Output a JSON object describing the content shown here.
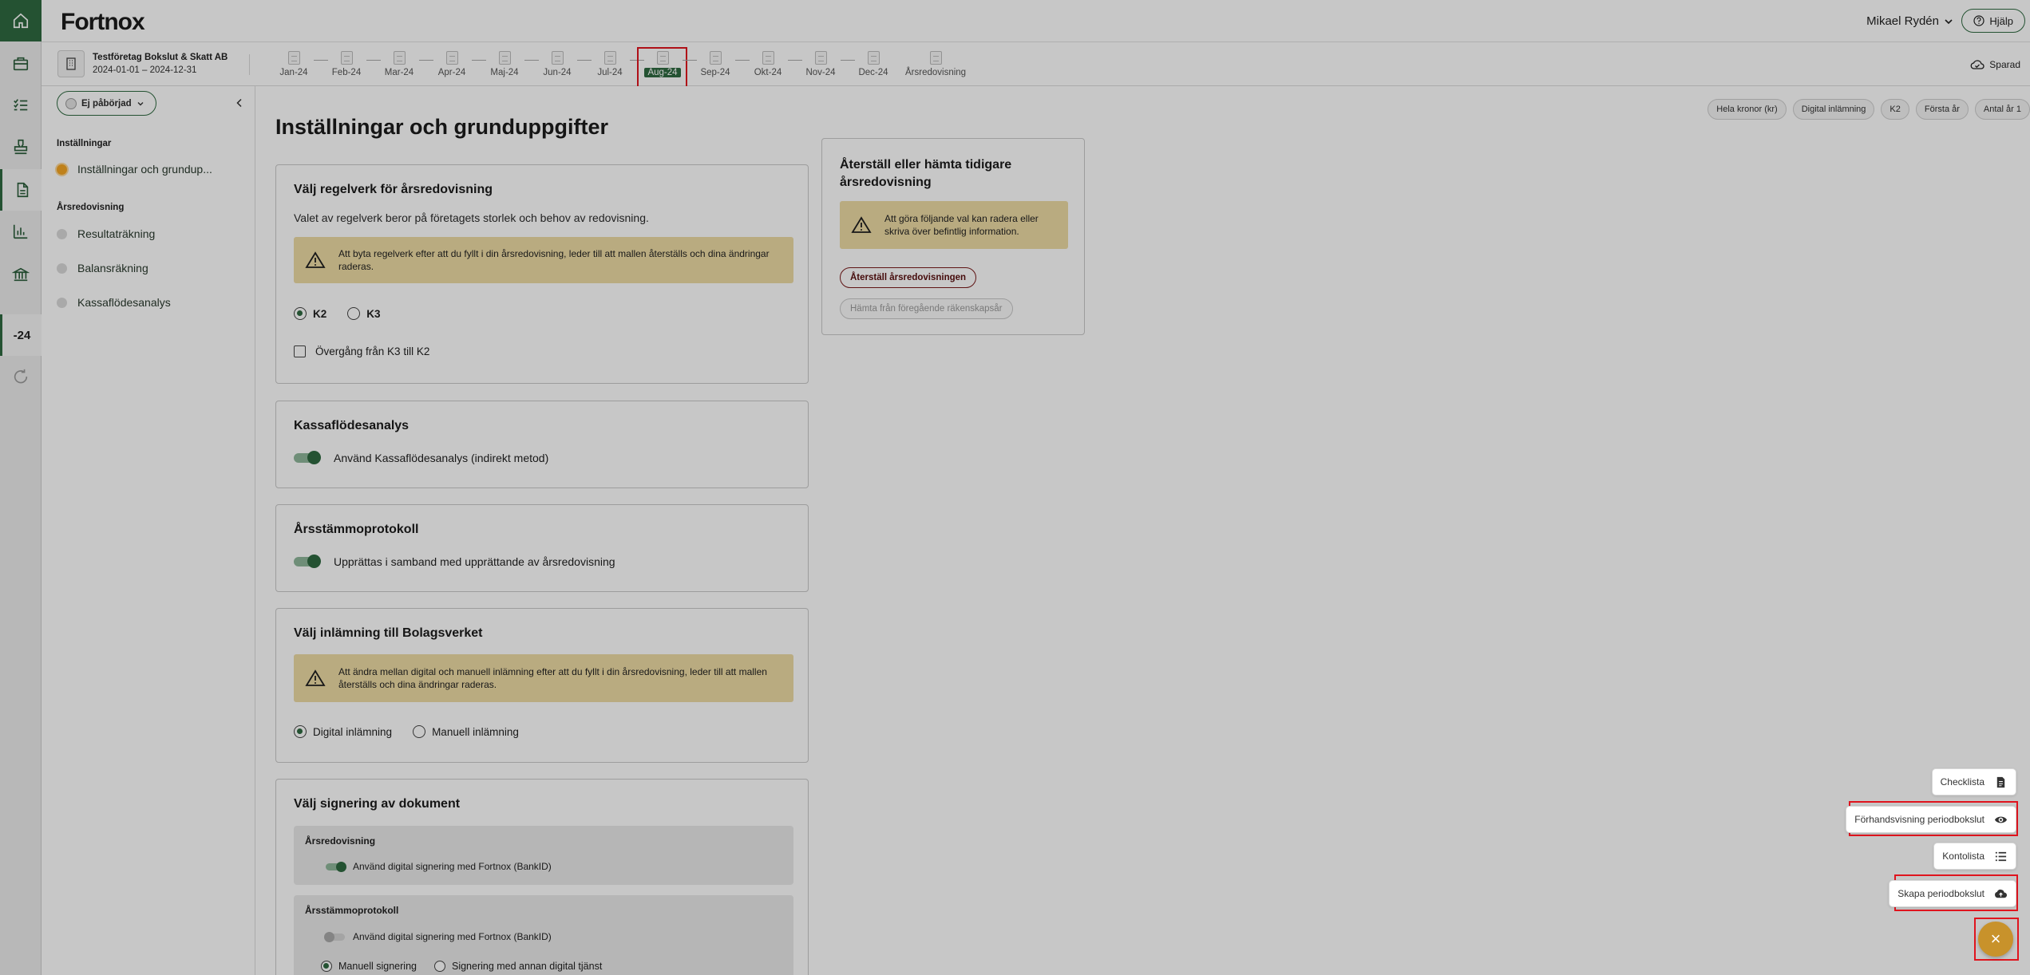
{
  "brand": {
    "logo": "Fortnox",
    "accent": "#2f6a40"
  },
  "rail": {
    "icons": [
      "home-icon",
      "briefcase-icon",
      "checklist-icon",
      "stamp-icon",
      "document-icon",
      "bar-chart-icon",
      "bank-icon",
      "refresh-icon"
    ],
    "year_label": "-24"
  },
  "header": {
    "user_name": "Mikael Rydén",
    "help_label": "Hjälp"
  },
  "period_bar": {
    "company_name": "Testföretag Bokslut & Skatt AB",
    "company_dates": "2024-01-01 – 2024-12-31",
    "months": [
      "Jan-24",
      "Feb-24",
      "Mar-24",
      "Apr-24",
      "Maj-24",
      "Jun-24",
      "Jul-24",
      "Aug-24",
      "Sep-24",
      "Okt-24",
      "Nov-24",
      "Dec-24",
      "Årsredovisning"
    ],
    "active_month": "Aug-24",
    "saved_label": "Sparad"
  },
  "sidebar": {
    "status_label": "Ej påbörjad",
    "section_settings": "Inställningar",
    "settings_item": "Inställningar och grundup...",
    "section_report": "Årsredovisning",
    "report_items": [
      "Resultaträkning",
      "Balansräkning",
      "Kassaflödesanalys"
    ]
  },
  "main": {
    "title": "Inställningar och grunduppgifter",
    "chips": [
      "Hela kronor (kr)",
      "Digital inlämning",
      "K2",
      "Första år",
      "Antal år 1"
    ],
    "regelverk": {
      "title": "Välj regelverk för årsredovisning",
      "description": "Valet av regelverk beror på företagets storlek och behov av redovisning.",
      "warning": "Att byta regelverk efter att du fyllt i din årsredovisning, leder till att mallen återställs och dina ändringar raderas.",
      "option_k2": "K2",
      "option_k3": "K3",
      "checkbox_label": "Övergång från K3 till K2"
    },
    "kassaflode": {
      "title": "Kassaflödesanalys",
      "toggle_label": "Använd Kassaflödesanalys (indirekt metod)"
    },
    "arsstamma": {
      "title": "Årsstämmoprotokoll",
      "toggle_label": "Upprättas i samband med upprättande av årsredovisning"
    },
    "inlamning": {
      "title": "Välj inlämning till Bolagsverket",
      "warning": "Att ändra mellan digital och manuell inlämning efter att du fyllt i din årsredovisning, leder till att mallen återställs och dina ändringar raderas.",
      "option_digital": "Digital inlämning",
      "option_manual": "Manuell inlämning"
    },
    "signering": {
      "title": "Välj signering av dokument",
      "sub1_title": "Årsredovisning",
      "sub1_toggle": "Använd digital signering med Fortnox (BankID)",
      "sub2_title": "Årsstämmoprotokoll",
      "sub2_toggle": "Använd digital signering med Fortnox (BankID)",
      "sub2_option_manual": "Manuell signering",
      "sub2_option_other": "Signering med annan digital tjänst"
    },
    "restore": {
      "title": "Återställ eller hämta tidigare årsredovisning",
      "warning": "Att göra följande val kan radera eller skriva över befintlig information.",
      "reset_button": "Återställ årsredovisningen",
      "fetch_button": "Hämta från föregående räkenskapsår"
    }
  },
  "fab_menu": {
    "items": [
      "Checklista",
      "Förhandsvisning periodbokslut",
      "Kontolista",
      "Skapa periodbokslut"
    ],
    "close_symbol": "×"
  }
}
